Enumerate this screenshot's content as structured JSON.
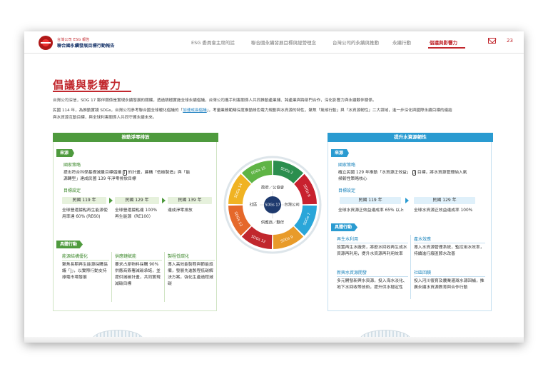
{
  "header": {
    "brand_line1": "台灣公司 ESG 報告",
    "brand_line2": "聯合國永續發展目標行動報告",
    "nav": [
      {
        "label": "ESG 委員會主席的話",
        "active": false
      },
      {
        "label": "聯合國永續發展目標與經營理念",
        "active": false
      },
      {
        "label": "台灣公司的永續與推動",
        "active": false
      },
      {
        "label": "永續行動",
        "active": false
      },
      {
        "label": "倡議與影響力",
        "active": true
      }
    ],
    "page_number": "23"
  },
  "page": {
    "title": "倡議與影響力",
    "para1": "台灣公司深信，SDG 17 夥伴關係是實現永續發展的關鍵，透過積極實施全球永續倡議，台灣公司攜手利害關係人共同推動產業鏈、跨產業與跨部門合作，深化影響力與永續夥伴關係。",
    "para2_a": "民國 114 年，為推動實踐 SDGs，台灣公司參考聯合國全球暖化倡議的「",
    "para2_link": "加速成長倡議",
    "para2_b": "」，考量業務範疇深度推動綠色電力規劃與水資源的特性，聚焦「氣候行動」與「水資源韌性」二大領域，進一步深化與國際永續目標的連結",
    "para3": "與水資源互動目標，與全球利害關係人共同守護永續未來。"
  },
  "left_panel": {
    "header": "推動淨零排放",
    "tag_source": "來源",
    "source_title": "國家策略",
    "source_text_1": "提出符合科學基礎減量目標倡議",
    "source_badge": "J",
    "source_text_2": "的計畫，建構「低碳製造」與「能",
    "source_text_3": "源轉型」達成民國 139 年淨零排放目標",
    "goal_title": "目標設定",
    "milestones": [
      "民國 119 年",
      "民國 129 年",
      "民國 139 年"
    ],
    "goal_descs": [
      "全球營運據點再生能源使用率達 60% (RE60)",
      "全球營運據點達 100% 再生能源（RE100）",
      "達成淨零排放"
    ],
    "tag_action": "具體行動",
    "actions": [
      {
        "title": "能源結構優化",
        "text": "聚焦長期再生能源採購協議「J」，以實際行動支持綠電市場發展"
      },
      {
        "title": "供應鏈賦能",
        "text": "要求占原物料採購 90% 供應商簽署減碳承諾，並提供減碳計畫，共同實現減碳目標"
      },
      {
        "title": "製程低碳化",
        "text": "導入高效能製程與節能設備，發展先進製程低碳解決方案，強化生產過程減碳"
      }
    ]
  },
  "right_panel": {
    "header": "提升水資源韌性",
    "tag_source": "來源",
    "source_title": "國家策略",
    "source_text_1": "確立民國 129 年推動「水資源正效益」",
    "source_badge": "J",
    "source_text_2": "目標，將水資源管理納入氣",
    "source_text_3": "候韌性策略核心",
    "goal_title": "目標設定",
    "milestones": [
      "民國 119 年",
      "民國 129 年"
    ],
    "goal_descs": [
      "全球水資源正效益達成率 65% 以上",
      "全球水資源正效益達成率 100%"
    ],
    "tag_action": "具體行動",
    "actions": [
      {
        "title": "再生水利用",
        "text": "設置再生水廠房，將廢水回收再生成水資源再利用，提升水資源再利用效率"
      },
      {
        "title": "產水效應",
        "text": "導入水資源管理系統，監控用水效率，持續進行廠區節水改善"
      },
      {
        "title": "新興水資源開發",
        "text": "多元開發新興水資源，投入海水淡化、地下水回收等技術，提升供水穩定性"
      },
      {
        "title": "社區回饋",
        "text": "投入河川復育及農業灌溉水源回補，推廣永續水資源教育與合作行動"
      }
    ]
  },
  "diagram": {
    "center_label": "SDGs 17",
    "inner_labels": [
      "政府／公協會",
      "台灣公司",
      "供應商／夥伴",
      "社區"
    ],
    "segments": [
      {
        "label": "SDGs 2",
        "color": "#2b8e4e"
      },
      {
        "label": "SDGs 6",
        "color": "#c8212e"
      },
      {
        "label": "SDGs 7",
        "color": "#2aa6d9"
      },
      {
        "label": "SDGs 9",
        "color": "#e89b2a"
      },
      {
        "label": "SDGs 12",
        "color": "#c1272d"
      },
      {
        "label": "SDGs 13",
        "color": "#e5682a"
      },
      {
        "label": "SDGs 14",
        "color": "#f0b323"
      },
      {
        "label": "SDGs 15",
        "color": "#5fb445"
      }
    ]
  }
}
